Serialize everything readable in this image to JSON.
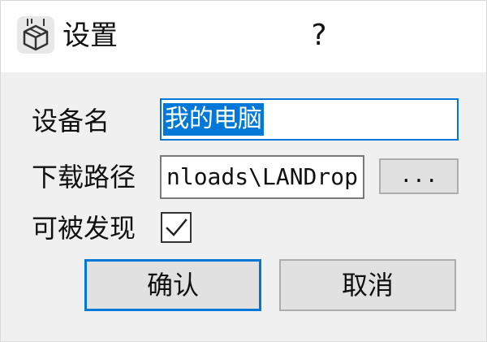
{
  "window": {
    "title": "设置",
    "help_label": "?"
  },
  "form": {
    "device_name_label": "设备名",
    "device_name_value": "我的电脑",
    "download_path_label": "下载路径",
    "download_path_value": "nloads\\LANDrop",
    "browse_label": "...",
    "discoverable_label": "可被发现",
    "discoverable_checked": true
  },
  "buttons": {
    "ok_label": "确认",
    "cancel_label": "取消"
  },
  "colors": {
    "accent": "#0078d7",
    "window_bg": "#f0f0f0",
    "button_bg": "#e1e1e1"
  }
}
